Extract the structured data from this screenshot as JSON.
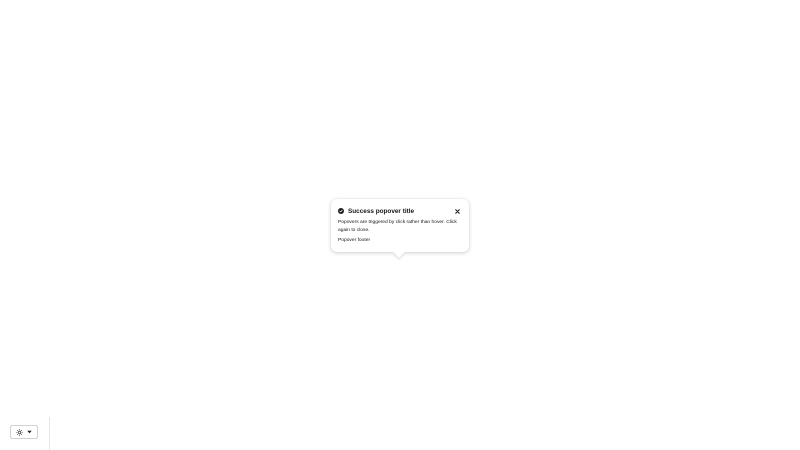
{
  "popover": {
    "title": "Success popover title",
    "body": "Popovers are triggered by click rather than hover. Click again to close.",
    "footer": "Popover footer",
    "icon": "check-circle-icon",
    "close_icon": "close-icon"
  },
  "theme_switcher": {
    "icon": "sun-icon",
    "caret_icon": "caret-down-icon"
  },
  "colors": {
    "text": "#151515",
    "icon": "#1e1e1e",
    "border": "#d2d2d2"
  }
}
